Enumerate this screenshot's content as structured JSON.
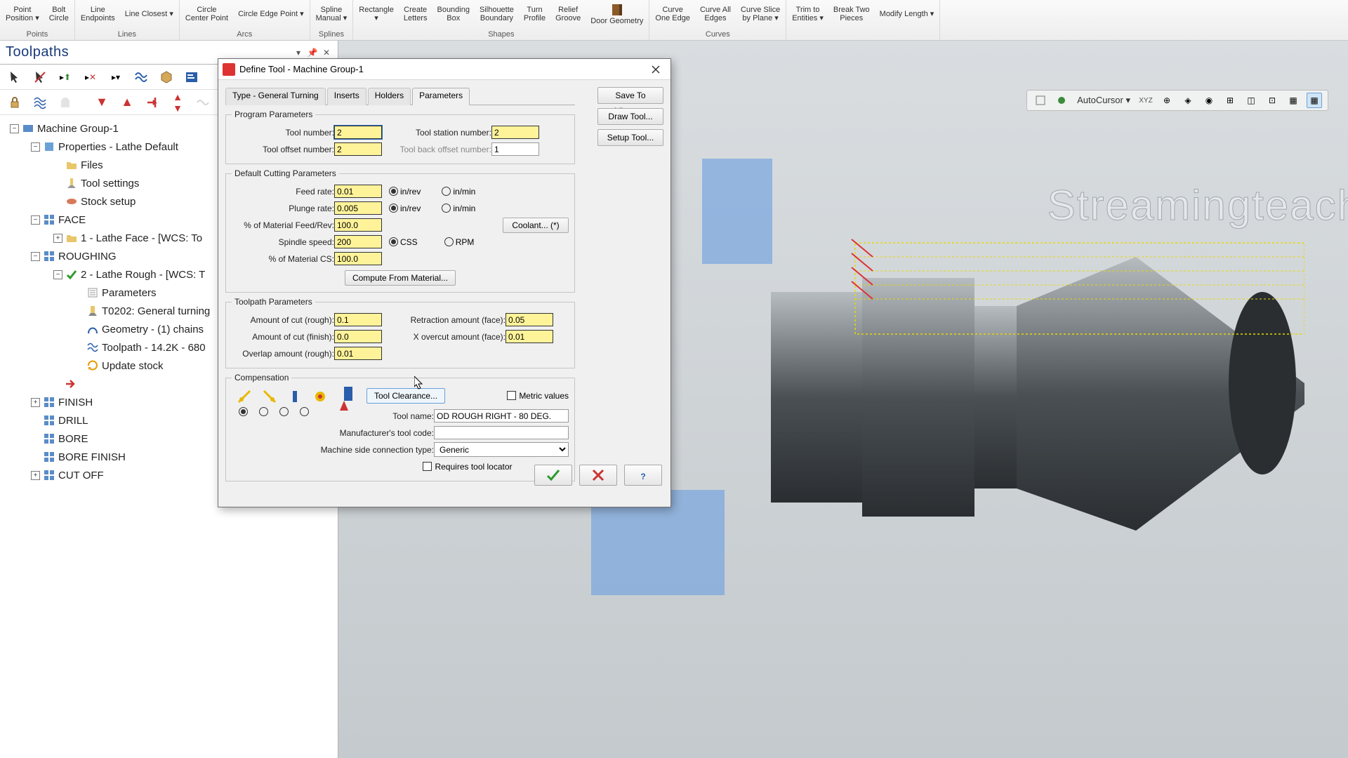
{
  "ribbon": {
    "groups": [
      {
        "label": "Points",
        "items": [
          {
            "name": "point-position",
            "label": "Point\nPosition ▾"
          },
          {
            "name": "bolt-circle",
            "label": "Bolt\nCircle"
          }
        ]
      },
      {
        "label": "Lines",
        "items": [
          {
            "name": "line-endpoints",
            "label": "Line\nEndpoints"
          },
          {
            "name": "line-closest",
            "label": "Line Closest ▾"
          }
        ]
      },
      {
        "label": "Arcs",
        "items": [
          {
            "name": "circle-center-point",
            "label": "Circle\nCenter Point"
          },
          {
            "name": "circle-edge-point",
            "label": "Circle Edge Point ▾"
          }
        ]
      },
      {
        "label": "Splines",
        "items": [
          {
            "name": "spline-manual",
            "label": "Spline\nManual ▾"
          }
        ]
      },
      {
        "label": "Shapes",
        "items": [
          {
            "name": "rectangle",
            "label": "Rectangle\n▾"
          },
          {
            "name": "create-letters",
            "label": "Create\nLetters"
          },
          {
            "name": "bounding-box",
            "label": "Bounding\nBox"
          },
          {
            "name": "silhouette-boundary",
            "label": "Silhouette\nBoundary"
          },
          {
            "name": "turn-profile",
            "label": "Turn\nProfile"
          },
          {
            "name": "relief-groove",
            "label": "Relief\nGroove"
          },
          {
            "name": "door-geometry",
            "label": "Door Geometry"
          }
        ]
      },
      {
        "label": "Curves",
        "items": [
          {
            "name": "curve-one-edge",
            "label": "Curve\nOne Edge"
          },
          {
            "name": "curve-all-edges",
            "label": "Curve All\nEdges"
          },
          {
            "name": "curve-slice-by-plane",
            "label": "Curve Slice\nby Plane ▾"
          }
        ]
      },
      {
        "label": "",
        "items": [
          {
            "name": "trim-to-entities",
            "label": "Trim to\nEntities ▾"
          },
          {
            "name": "break-two-pieces",
            "label": "Break Two\nPieces"
          },
          {
            "name": "modify-length",
            "label": "Modify Length ▾"
          }
        ]
      }
    ]
  },
  "quickbar": {
    "autocursor": "AutoCursor ▾"
  },
  "panel": {
    "title": "Toolpaths"
  },
  "tree": {
    "items": [
      {
        "indent": 1,
        "exp": "-",
        "icon": "machine-icon",
        "label": "Machine Group-1"
      },
      {
        "indent": 2,
        "exp": "-",
        "icon": "properties-icon",
        "label": "Properties - Lathe Default"
      },
      {
        "indent": 3,
        "exp": "",
        "icon": "folder-icon",
        "label": "Files"
      },
      {
        "indent": 3,
        "exp": "",
        "icon": "tool-settings-icon",
        "label": "Tool settings"
      },
      {
        "indent": 3,
        "exp": "",
        "icon": "stock-icon",
        "label": "Stock setup"
      },
      {
        "indent": 2,
        "exp": "-",
        "icon": "op-group-icon",
        "label": "FACE"
      },
      {
        "indent": 3,
        "exp": "+",
        "icon": "op-icon",
        "label": "1 - Lathe Face - [WCS: To"
      },
      {
        "indent": 2,
        "exp": "-",
        "icon": "op-group-icon",
        "label": "ROUGHING"
      },
      {
        "indent": 3,
        "exp": "-",
        "icon": "op-check-icon",
        "label": "2 - Lathe Rough - [WCS: T"
      },
      {
        "indent": 4,
        "exp": "",
        "icon": "params-icon",
        "label": "Parameters"
      },
      {
        "indent": 4,
        "exp": "",
        "icon": "tool-icon",
        "label": "T0202: General turning"
      },
      {
        "indent": 4,
        "exp": "",
        "icon": "geo-icon",
        "label": "Geometry - (1) chains"
      },
      {
        "indent": 4,
        "exp": "",
        "icon": "path-icon",
        "label": "Toolpath - 14.2K - 680"
      },
      {
        "indent": 4,
        "exp": "",
        "icon": "update-icon",
        "label": "Update stock"
      },
      {
        "indent": 3,
        "exp": "",
        "icon": "insert-arrow-icon",
        "label": ""
      },
      {
        "indent": 2,
        "exp": "+",
        "icon": "op-group-icon",
        "label": "FINISH"
      },
      {
        "indent": 2,
        "exp": "",
        "icon": "op-group-icon",
        "label": "DRILL"
      },
      {
        "indent": 2,
        "exp": "",
        "icon": "op-group-icon",
        "label": "BORE"
      },
      {
        "indent": 2,
        "exp": "",
        "icon": "op-group-icon",
        "label": "BORE FINISH"
      },
      {
        "indent": 2,
        "exp": "+",
        "icon": "op-group-icon",
        "label": "CUT OFF"
      }
    ]
  },
  "watermark": "Streamingteach",
  "dialog": {
    "title": "Define Tool - Machine Group-1",
    "tabs": [
      "Type - General Turning",
      "Inserts",
      "Holders",
      "Parameters"
    ],
    "active_tab": "Parameters",
    "side": [
      "Save To Library...",
      "Draw Tool...",
      "Setup Tool..."
    ],
    "program_params": {
      "legend": "Program Parameters",
      "tool_number_lbl": "Tool number:",
      "tool_number": "2",
      "tool_station_lbl": "Tool station number:",
      "tool_station": "2",
      "tool_offset_lbl": "Tool offset number:",
      "tool_offset": "2",
      "tool_back_offset_lbl": "Tool back offset number:",
      "tool_back_offset": "1"
    },
    "cutting_params": {
      "legend": "Default Cutting Parameters",
      "feed_rate_lbl": "Feed rate:",
      "feed_rate": "0.01",
      "plunge_rate_lbl": "Plunge rate:",
      "plunge_rate": "0.005",
      "pct_feed_lbl": "% of Material Feed/Rev:",
      "pct_feed": "100.0",
      "spindle_lbl": "Spindle speed:",
      "spindle": "200",
      "pct_cs_lbl": "% of Material CS:",
      "pct_cs": "100.0",
      "inrev": "in/rev",
      "inmin": "in/min",
      "css": "CSS",
      "rpm": "RPM",
      "coolant_btn": "Coolant... (*)",
      "compute_btn": "Compute From Material..."
    },
    "toolpath_params": {
      "legend": "Toolpath Parameters",
      "cut_rough_lbl": "Amount of cut (rough):",
      "cut_rough": "0.1",
      "cut_finish_lbl": "Amount of cut (finish):",
      "cut_finish": "0.0",
      "overlap_lbl": "Overlap amount (rough):",
      "overlap": "0.01",
      "retract_lbl": "Retraction amount (face):",
      "retract": "0.05",
      "xover_lbl": "X overcut amount (face):",
      "xover": "0.01"
    },
    "compensation": {
      "legend": "Compensation",
      "clearance_btn": "Tool Clearance...",
      "metric_lbl": "Metric values",
      "tool_name_lbl": "Tool name:",
      "tool_name": "OD ROUGH RIGHT - 80 DEG.",
      "mfg_code_lbl": "Manufacturer's tool code:",
      "mfg_code": "",
      "conn_type_lbl": "Machine side connection type:",
      "conn_type": "Generic",
      "req_locator_lbl": "Requires tool locator"
    }
  }
}
